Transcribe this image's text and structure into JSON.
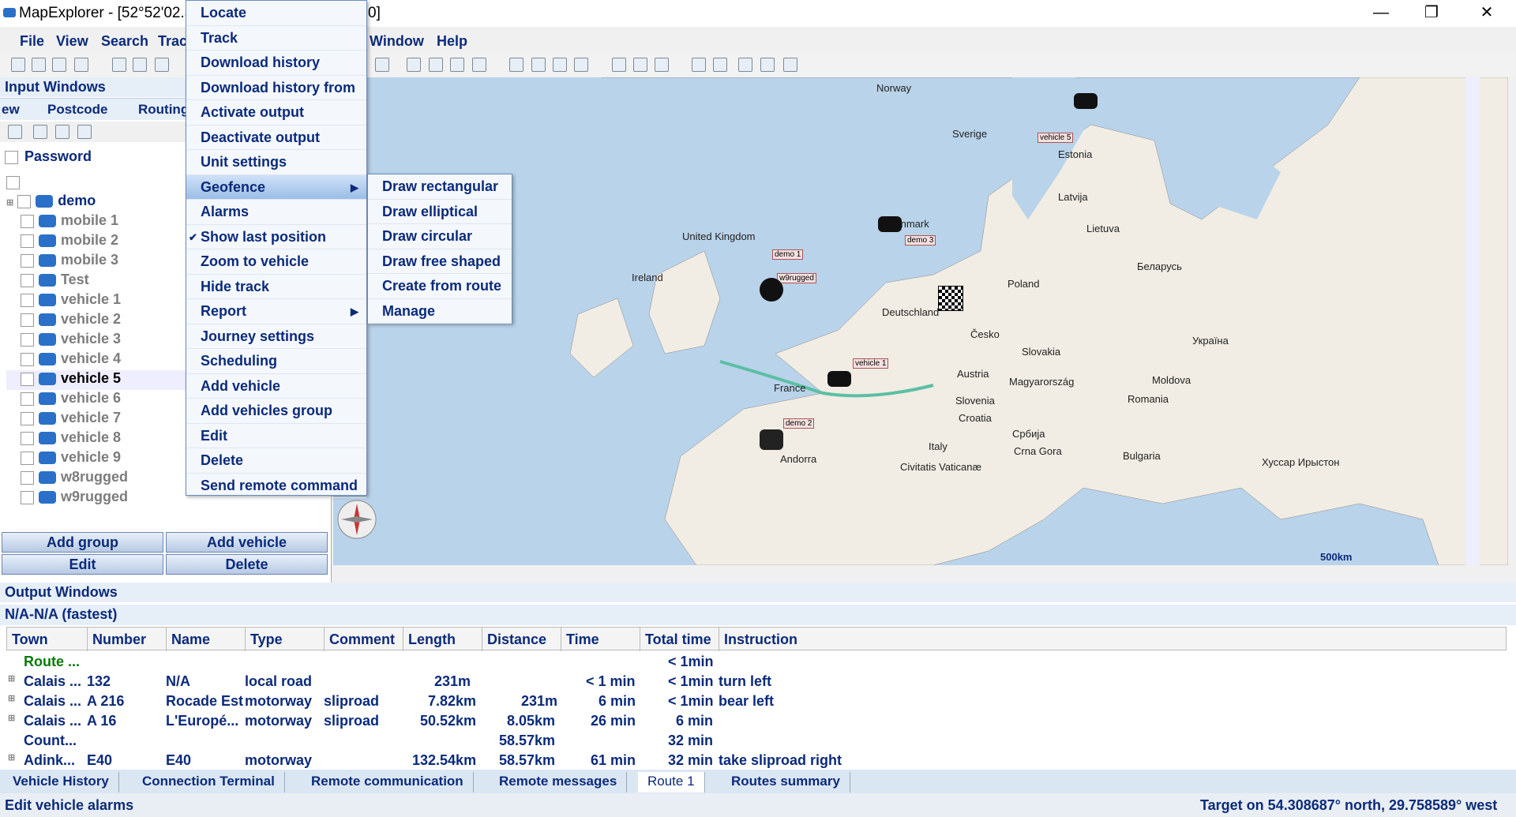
{
  "app": {
    "title": "MapExplorer - [52°52'02.5",
    "title_tail": "0]"
  },
  "window_controls": {
    "minimize": "—",
    "maximize": "❐",
    "close": "✕"
  },
  "menubar": [
    "File",
    "View",
    "Search",
    "Trac",
    "Window",
    "Help"
  ],
  "input_panel": {
    "header": "Input Windows",
    "tabs": [
      "ew",
      "Postcode",
      "Routing"
    ],
    "password_label": "Password",
    "tree": [
      "demo",
      "mobile 1",
      "mobile 2",
      "mobile 3",
      "Test",
      "vehicle 1",
      "vehicle 2",
      "vehicle 3",
      "vehicle 4",
      "vehicle 5",
      "vehicle 6",
      "vehicle 7",
      "vehicle 8",
      "vehicle 9",
      "w8rugged",
      "w9rugged"
    ],
    "buttons": {
      "add_group": "Add group",
      "add_vehicle": "Add vehicle",
      "edit": "Edit",
      "delete": "Delete"
    }
  },
  "context_menu": [
    "Locate",
    "Track",
    "Download history",
    "Download history from",
    "Activate output",
    "Deactivate output",
    "Unit settings",
    "Geofence",
    "Alarms",
    "Show last position",
    "Zoom to vehicle",
    "Hide track",
    "Report",
    "Journey settings",
    "Scheduling",
    "Add vehicle",
    "Add vehicles group",
    "Edit",
    "Delete",
    "Send remote command"
  ],
  "geofence_submenu": [
    "Draw rectangular",
    "Draw elliptical",
    "Draw circular",
    "Draw free shaped",
    "Create from route",
    "Manage"
  ],
  "map": {
    "labels": [
      "Norway",
      "Sverige",
      "Estonia",
      "Latvija",
      "Lietuva",
      "Danmark",
      "United Kingdom",
      "Ireland",
      "Poland",
      "Беларусь",
      "Deutschland",
      "Česko",
      "Україна",
      "Slovakia",
      "Austria",
      "Magyarország",
      "Moldova",
      "France",
      "Slovenia",
      "Romania",
      "Croatia",
      "Србија",
      "Italy",
      "Crna Gora",
      "Bulgaria",
      "Civitatis Vaticanæ",
      "Andorra",
      "Хуссар Ирыстон"
    ],
    "vehicle_labels": [
      "vehicle 5",
      "demo 3",
      "demo 1",
      "w9rugged",
      "vehicle 1",
      "demo 2"
    ],
    "scale": "500km"
  },
  "output_panel": {
    "header": "Output Windows",
    "subheader": "N/A-N/A (fastest)",
    "columns": [
      "Town",
      "Number",
      "Name",
      "Type",
      "Comment",
      "Length",
      "Distance",
      "Time",
      "Total time",
      "Instruction"
    ],
    "rows": [
      [
        "Route ...",
        "",
        "",
        "",
        "",
        "",
        "",
        "",
        "< 1min",
        ""
      ],
      [
        "Calais ...",
        "132",
        "N/A",
        "local road",
        "",
        "231m",
        "",
        "< 1 min",
        "< 1min",
        "turn left"
      ],
      [
        "Calais ...",
        "A 216",
        "Rocade Est",
        "motorway",
        "sliproad",
        "7.82km",
        "231m",
        "6 min",
        "< 1min",
        "bear left"
      ],
      [
        "Calais ...",
        "A 16",
        "L'Europé...",
        "motorway",
        "sliproad",
        "50.52km",
        "8.05km",
        "26 min",
        "6 min",
        ""
      ],
      [
        "Count...",
        "",
        "",
        "",
        "",
        "",
        "58.57km",
        "",
        "32 min",
        ""
      ],
      [
        "Adink...",
        "E40",
        "E40",
        "motorway",
        "",
        "132.54km",
        "58.57km",
        "61 min",
        "32 min",
        "take sliproad right"
      ]
    ]
  },
  "bottom_tabs": [
    "Vehicle History",
    "Connection Terminal",
    "Remote communication",
    "Remote messages",
    "Route 1",
    "Routes summary"
  ],
  "status": {
    "left": "Edit vehicle alarms",
    "right": "Target on 54.308687° north, 29.758589° west"
  }
}
